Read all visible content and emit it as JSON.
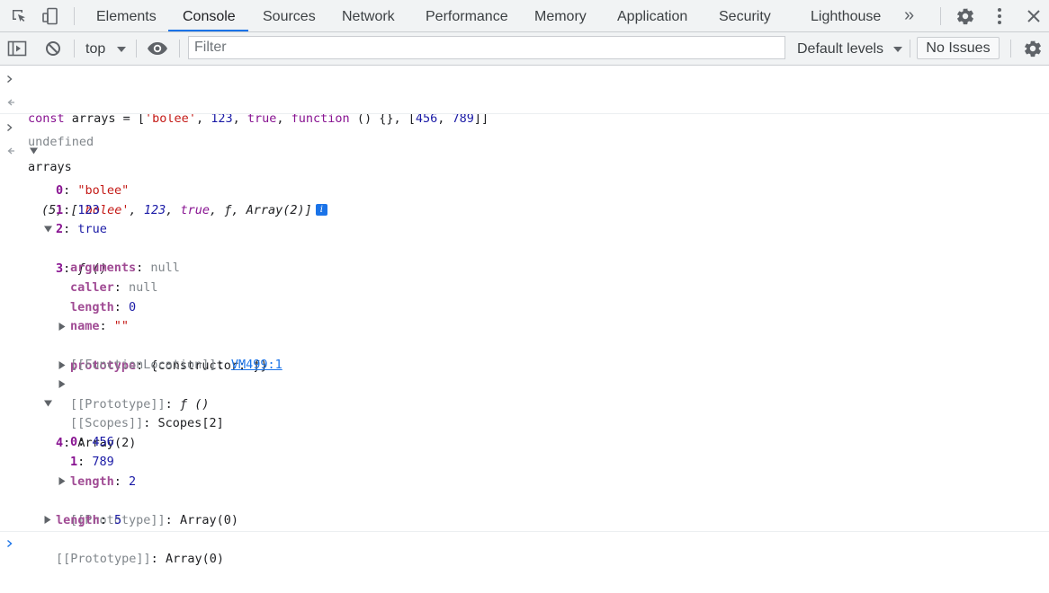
{
  "tabs": {
    "items": [
      "Elements",
      "Console",
      "Sources",
      "Network",
      "Performance",
      "Memory",
      "Application",
      "Security",
      "Lighthouse"
    ],
    "active": "Console",
    "more_glyph": "»"
  },
  "toolbar": {
    "context": "top",
    "filter_placeholder": "Filter",
    "levels_label": "Default levels",
    "issues_label": "No Issues"
  },
  "console": {
    "input1": {
      "kw_const": "const",
      "name": " arrays = [",
      "s1": "'bolee'",
      "c1": ", ",
      "n1": "123",
      "c2": ", ",
      "b1": "true",
      "c3": ", ",
      "fn": "function",
      "fn_rest": " () {}, [",
      "n2": "456",
      "c4": ", ",
      "n3": "789",
      "end": "]]"
    },
    "result1": "undefined",
    "input2": "arrays",
    "summary": {
      "count": "(5) [",
      "s1": "'bolee'",
      "c1": ", ",
      "n1": "123",
      "c2": ", ",
      "b1": "true",
      "c3": ", ",
      "f": "ƒ",
      "c4": ", Array(2)]"
    },
    "items": {
      "k0": "0",
      "v0": "\"bolee\"",
      "k1": "1",
      "v1": "123",
      "k2": "2",
      "v2": "true",
      "k3": "3",
      "v3": "ƒ ()",
      "f_arguments_k": "arguments",
      "f_arguments_v": "null",
      "f_caller_k": "caller",
      "f_caller_v": "null",
      "f_length_k": "length",
      "f_length_v": "0",
      "f_name_k": "name",
      "f_name_v": "\"\"",
      "f_prototype_k": "prototype",
      "f_prototype_v": "{constructor: ƒ}",
      "f_location_k": "[[FunctionLocation]]",
      "f_location_v": "VM499:1",
      "f_proto_k": "[[Prototype]]",
      "f_proto_v": "ƒ ()",
      "f_scopes_k": "[[Scopes]]",
      "f_scopes_v": "Scopes[2]",
      "k4": "4",
      "v4": "Array(2)",
      "a_0_k": "0",
      "a_0_v": "456",
      "a_1_k": "1",
      "a_1_v": "789",
      "a_length_k": "length",
      "a_length_v": "2",
      "a_proto_k": "[[Prototype]]",
      "a_proto_v": "Array(0)",
      "length_k": "length",
      "length_v": "5",
      "proto_k": "[[Prototype]]",
      "proto_v": "Array(0)"
    }
  },
  "colors": {
    "accent": "#1a73e8",
    "keyword": "#881391",
    "string": "#c41a16",
    "number": "#1a1aa6"
  },
  "icons": [
    "inspect-element-icon",
    "device-toolbar-icon",
    "more-tabs-icon",
    "settings-gear-icon",
    "kebab-menu-icon",
    "close-icon",
    "sidebar-toggle-icon",
    "clear-console-icon",
    "dropdown-caret-icon",
    "eye-icon",
    "console-settings-gear-icon",
    "prompt-chevron-icon",
    "result-arrow-icon",
    "expand-triangle-icon",
    "collapse-triangle-icon",
    "info-badge-icon"
  ]
}
